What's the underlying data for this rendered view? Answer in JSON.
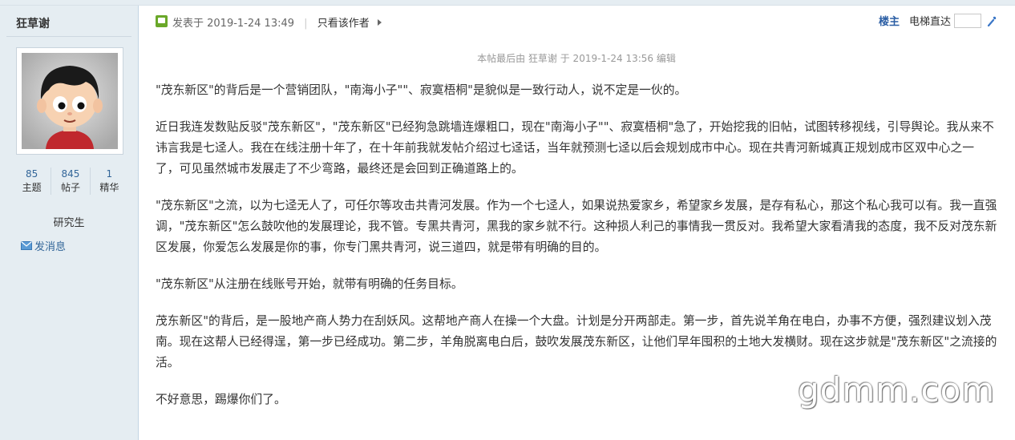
{
  "sidebar": {
    "username": "狂草谢",
    "stats": [
      {
        "value": "85",
        "label": "主题"
      },
      {
        "value": "845",
        "label": "帖子"
      },
      {
        "value": "1",
        "label": "精华"
      }
    ],
    "rank": "研究生",
    "send_message": "发消息"
  },
  "header": {
    "posted_at": "发表于 2019-1-24 13:49",
    "only_author": "只看该作者",
    "floor": "楼主",
    "jump_label": "电梯直达",
    "jump_value": ""
  },
  "edited_note": "本帖最后由 狂草谢 于 2019-1-24 13:56 编辑",
  "paragraphs": [
    "\"茂东新区\"的背后是一个营销团队，\"南海小子\"\"、寂寞梧桐\"是貌似是一致行动人，说不定是一伙的。",
    "近日我连发数贴反驳\"茂东新区\"，\"茂东新区\"已经狗急跳墙连爆粗口，现在\"南海小子\"\"、寂寞梧桐\"急了，开始挖我的旧帖，试图转移视线，引导舆论。我从来不讳言我是七迳人。我在在线注册十年了，在十年前我就发帖介绍过七迳话，当年就预测七迳以后会规划成市中心。现在共青河新城真正规划成市区双中心之一了，可见虽然城市发展走了不少弯路，最终还是会回到正确道路上的。",
    "\"茂东新区\"之流，以为七迳无人了，可任尔等攻击共青河发展。作为一个七迳人，如果说热爱家乡，希望家乡发展，是存有私心，那这个私心我可以有。我一直强调，\"茂东新区\"怎么鼓吹他的发展理论，我不管。专黑共青河，黑我的家乡就不行。这种损人利己的事情我一贯反对。我希望大家看清我的态度，我不反对茂东新区发展，你爱怎么发展是你的事，你专门黑共青河，说三道四，就是带有明确的目的。",
    "\"茂东新区\"从注册在线账号开始，就带有明确的任务目标。",
    "茂东新区\"的背后，是一股地产商人势力在刮妖风。这帮地产商人在操一个大盘。计划是分开两部走。第一步，首先说羊角在电白，办事不方便，强烈建议划入茂南。现在这帮人已经得逞，第一步已经成功。第二步，羊角脱离电白后，鼓吹发展茂东新区，让他们早年囤积的土地大发横财。现在这步就是\"茂东新区\"之流接的活。",
    "不好意思，踢爆你们了。"
  ],
  "watermark": "gdmm.com"
}
